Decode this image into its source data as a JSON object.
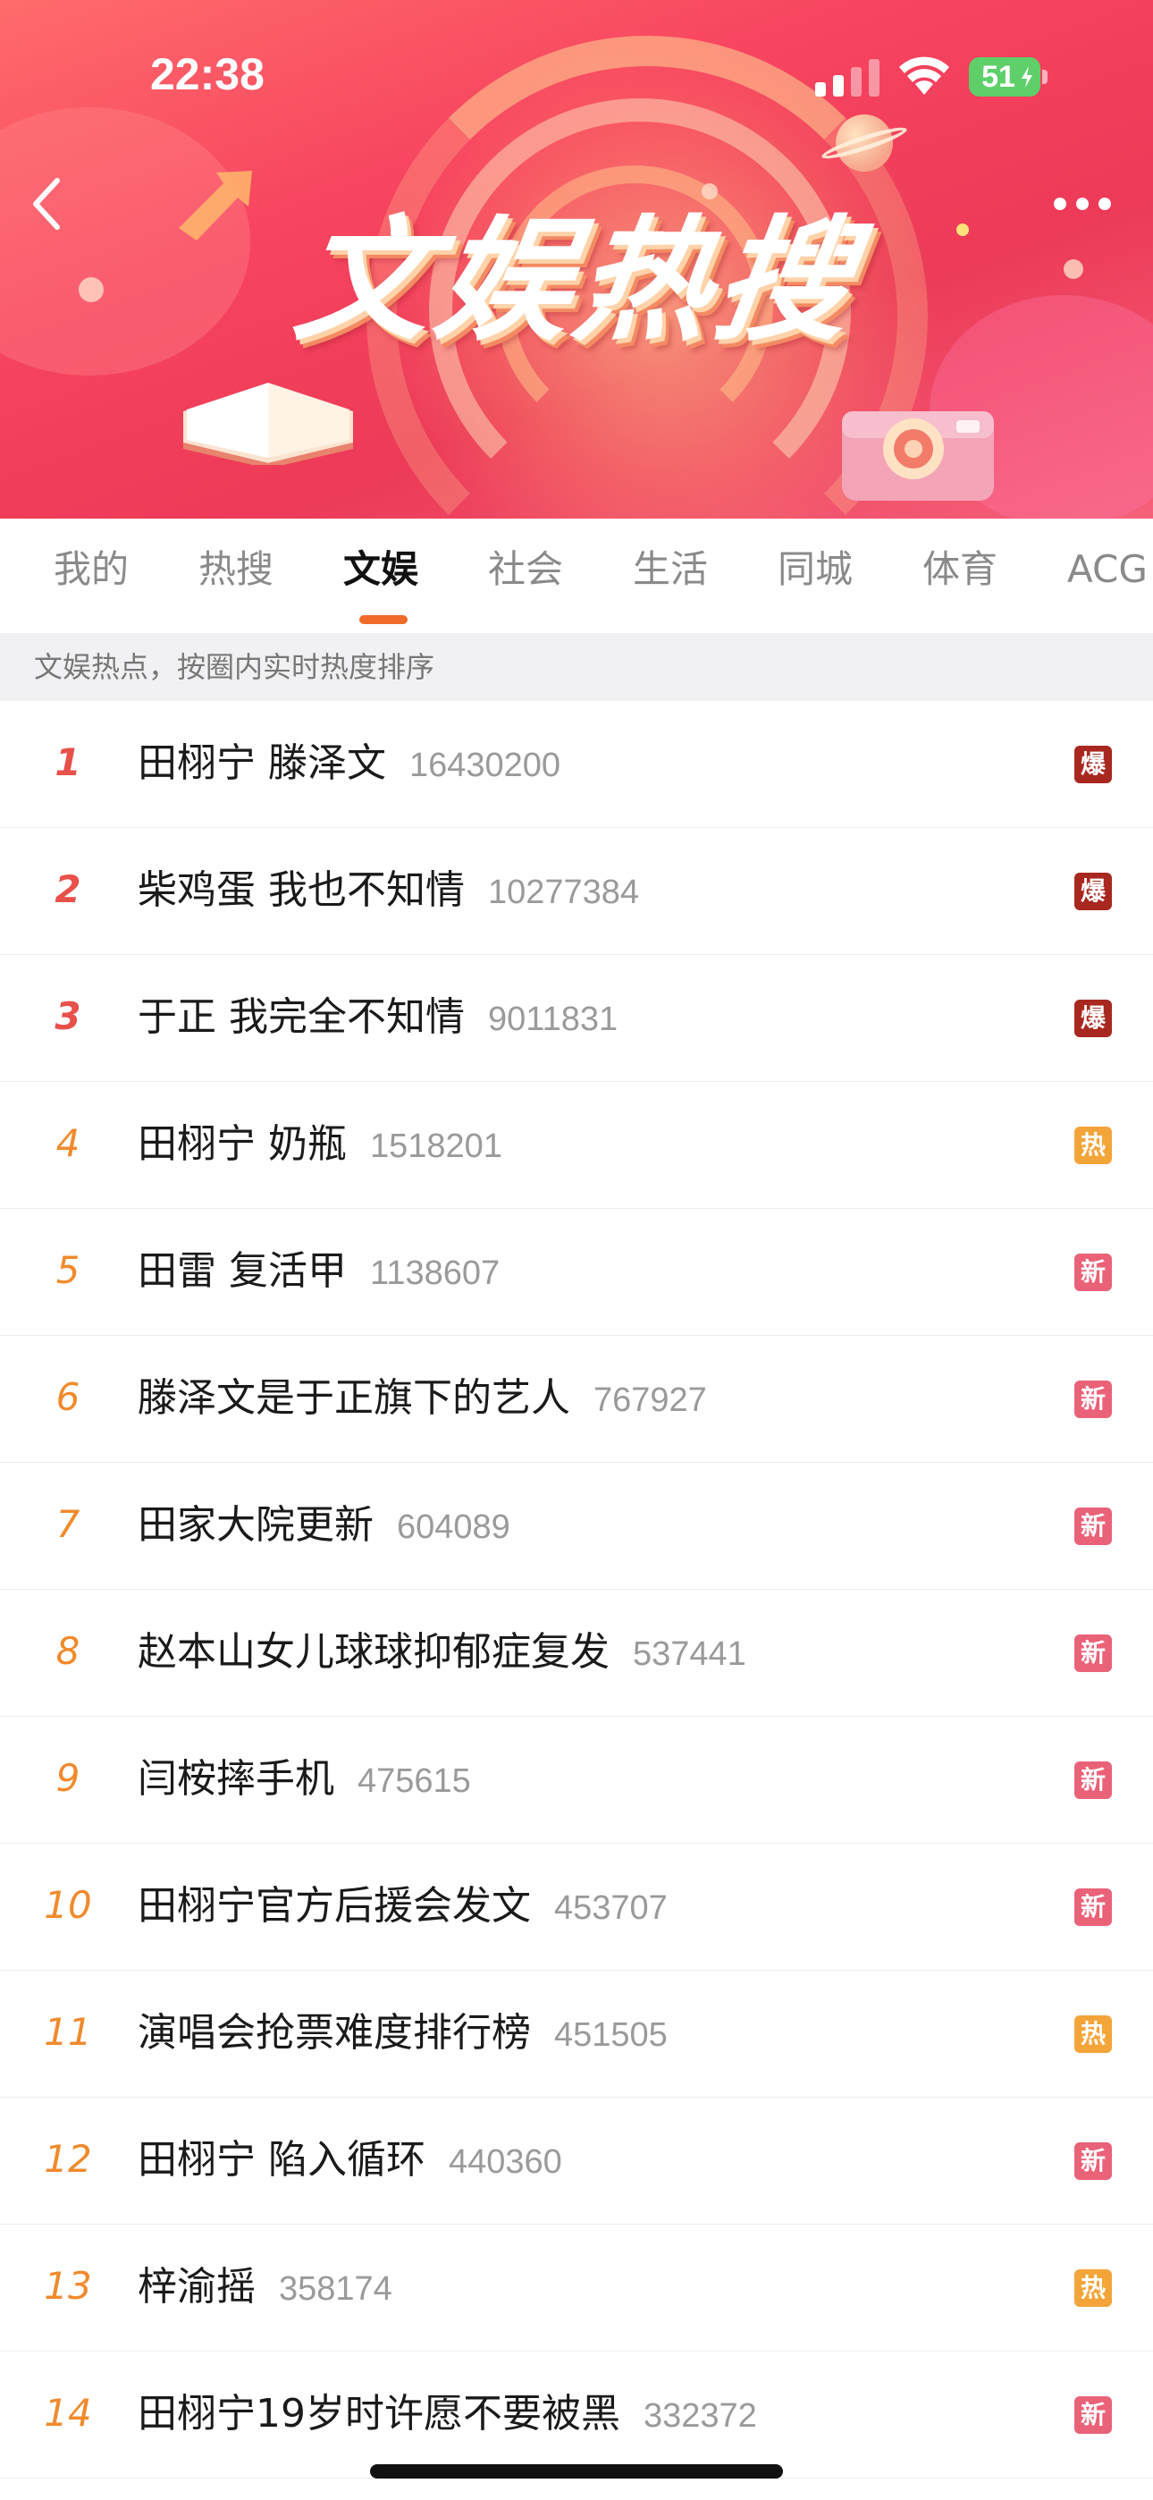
{
  "status_bar": {
    "time": "22:38",
    "battery": "51"
  },
  "header": {
    "title": "文娱热搜",
    "back_icon": "chevron-left-icon",
    "more_icon": "more-dots-icon"
  },
  "tabs": [
    {
      "label": "我的",
      "active": false
    },
    {
      "label": "热搜",
      "active": false
    },
    {
      "label": "文娱",
      "active": true
    },
    {
      "label": "社会",
      "active": false
    },
    {
      "label": "生活",
      "active": false
    },
    {
      "label": "同城",
      "active": false
    },
    {
      "label": "体育",
      "active": false
    },
    {
      "label": "ACG",
      "active": false
    }
  ],
  "subtitle": "文娱热点，按圈内实时热度排序",
  "badge_colors": {
    "爆": "#a8281f",
    "热": "#f3a53a",
    "新": "#ea6278"
  },
  "rank_colors": {
    "top": "#e8504a",
    "normal": "#f08a2c"
  },
  "items": [
    {
      "rank": "1",
      "topic": "田栩宁 滕泽文",
      "count": "16430200",
      "badge": "爆"
    },
    {
      "rank": "2",
      "topic": "柴鸡蛋 我也不知情",
      "count": "10277384",
      "badge": "爆"
    },
    {
      "rank": "3",
      "topic": "于正 我完全不知情",
      "count": "9011831",
      "badge": "爆"
    },
    {
      "rank": "4",
      "topic": "田栩宁 奶瓶",
      "count": "1518201",
      "badge": "热"
    },
    {
      "rank": "5",
      "topic": "田雷 复活甲",
      "count": "1138607",
      "badge": "新"
    },
    {
      "rank": "6",
      "topic": "滕泽文是于正旗下的艺人",
      "count": "767927",
      "badge": "新"
    },
    {
      "rank": "7",
      "topic": "田家大院更新",
      "count": "604089",
      "badge": "新"
    },
    {
      "rank": "8",
      "topic": "赵本山女儿球球抑郁症复发",
      "count": "537441",
      "badge": "新"
    },
    {
      "rank": "9",
      "topic": "闫桉摔手机",
      "count": "475615",
      "badge": "新"
    },
    {
      "rank": "10",
      "topic": "田栩宁官方后援会发文",
      "count": "453707",
      "badge": "新"
    },
    {
      "rank": "11",
      "topic": "演唱会抢票难度排行榜",
      "count": "451505",
      "badge": "热"
    },
    {
      "rank": "12",
      "topic": "田栩宁 陷入循环",
      "count": "440360",
      "badge": "新"
    },
    {
      "rank": "13",
      "topic": "梓渝摇",
      "count": "358174",
      "badge": "热"
    },
    {
      "rank": "14",
      "topic": "田栩宁19岁时许愿不要被黑",
      "count": "332372",
      "badge": "新"
    }
  ]
}
